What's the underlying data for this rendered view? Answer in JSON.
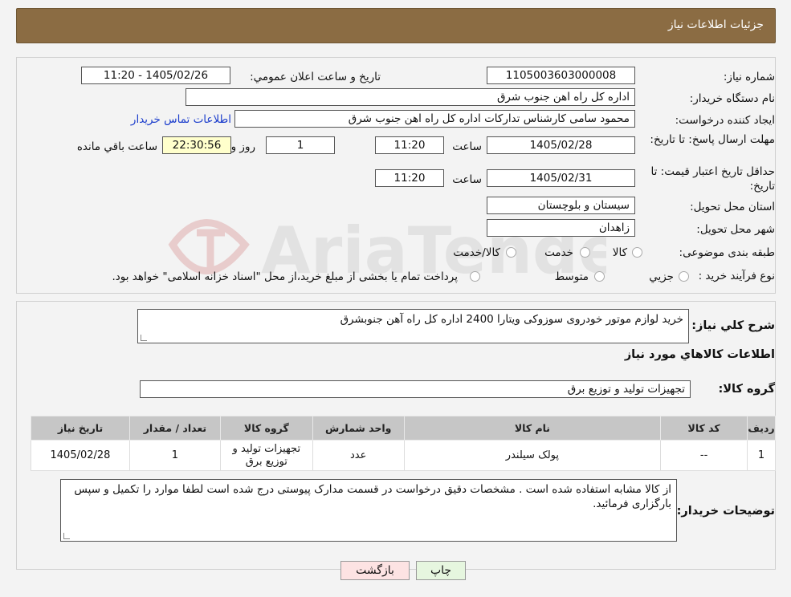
{
  "header": {
    "title": "جزئيات اطلاعات نياز"
  },
  "watermark": {
    "text": "AriaTender.neT"
  },
  "form": {
    "need_number_label": "شماره نياز:",
    "need_number": "1105003603000008",
    "announce_label": "تاريخ و ساعت اعلان عمومي:",
    "announce_value": "1405/02/26 - 11:20",
    "buyer_org_label": "نام دستگاه خريدار:",
    "buyer_org": "اداره کل راه اهن جنوب شرق",
    "creator_label": "ايجاد کننده درخواست:",
    "creator": "محمود سامی  کارشناس تدارکات  اداره کل راه اهن جنوب شرق",
    "contact_link": "اطلاعات تماس خريدار",
    "deadline_label": "مهلت ارسال پاسخ: تا تاريخ:",
    "deadline_date": "1405/02/28",
    "time_label": "ساعت",
    "deadline_time": "11:20",
    "days": "1",
    "days_label": "روز و",
    "remaining_time": "22:30:56",
    "remaining_label": "ساعت باقي مانده",
    "price_validity_label": "حداقل تاريخ اعتبار قيمت: تا تاريخ:",
    "price_validity_date": "1405/02/31",
    "price_validity_time": "11:20",
    "province_label": "استان محل تحويل:",
    "province": "سيستان و بلوچستان",
    "city_label": "شهر محل تحويل:",
    "city": "زاهدان",
    "category_label": "طبقه بندی موضوعی:",
    "category_options": [
      "کالا",
      "خدمت",
      "کالا/خدمت"
    ],
    "process_label": "نوع فرآيند خريد :",
    "process_options": [
      "جزيي",
      "متوسط"
    ],
    "process_note": "پرداخت تمام يا بخشی از مبلغ خريد،از محل \"اسناد خزانه اسلامی\" خواهد بود."
  },
  "summary": {
    "desc_label": "شرح کلي نياز:",
    "desc": "خرید لوازم موتور خودروی سوزوکی ویتارا 2400 اداره کل راه آهن جنوبشرق",
    "goods_info_title": "اطلاعات کالاهاي مورد نياز",
    "group_label": "گروه کالا:",
    "group": "تجهيزات توليد و توزيع برق"
  },
  "table": {
    "headers": [
      "رديف",
      "کد کالا",
      "نام کالا",
      "واحد شمارش",
      "گروه کالا",
      "تعداد / مقدار",
      "تاريخ نياز"
    ],
    "rows": [
      [
        "1",
        "--",
        "پولک سیلندر",
        "عدد",
        "تجهيزات توليد و توزيع برق",
        "1",
        "1405/02/28"
      ]
    ]
  },
  "buyer_notes": {
    "label": "توضيحات خريدار:",
    "text": "از کالا مشابه استفاده شده است . مشخصات دقیق درخواست در قسمت مدارک پیوستی درج شده است لطفا موارد را تکمیل و سپس بارگزاری فرمائید."
  },
  "buttons": {
    "print": "چاپ",
    "back": "بازگشت"
  }
}
